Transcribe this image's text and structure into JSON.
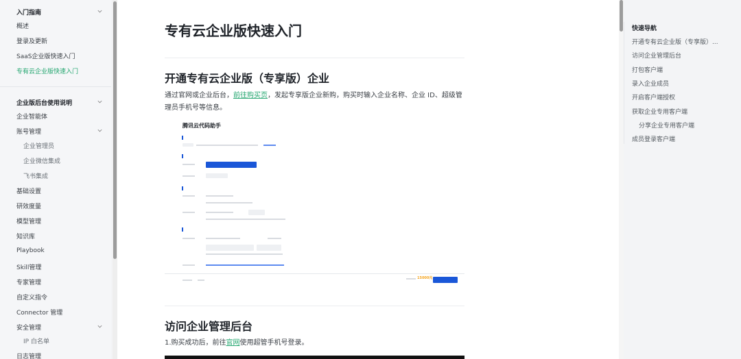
{
  "sidebar": {
    "group1": {
      "title": "入门指南",
      "items": [
        "概述",
        "登录及更新",
        "SaaS企业版快速入门",
        "专有云企业版快速入门"
      ]
    },
    "group2": {
      "title": "企业版后台使用说明",
      "items": [
        {
          "label": "企业智能体",
          "level": 1
        },
        {
          "label": "账号管理",
          "level": 1,
          "expanded": true
        },
        {
          "label": "企业管理员",
          "level": 2
        },
        {
          "label": "企业微信集成",
          "level": 2
        },
        {
          "label": "飞书集成",
          "level": 2
        },
        {
          "label": "基础设置",
          "level": 1
        },
        {
          "label": "研效度量",
          "level": 1
        },
        {
          "label": "模型管理",
          "level": 1
        },
        {
          "label": "知识库",
          "level": 1
        },
        {
          "label": "Playbook",
          "level": 1
        },
        {
          "label": "Skill管理",
          "level": 1
        },
        {
          "label": "专家管理",
          "level": 1
        },
        {
          "label": "自定义指令",
          "level": 1
        },
        {
          "label": "Connector 管理",
          "level": 1
        },
        {
          "label": "安全管理",
          "level": 1,
          "expanded": true
        },
        {
          "label": "IP 白名单",
          "level": 2
        },
        {
          "label": "日志管理",
          "level": 1
        }
      ]
    },
    "active_item": "专有云企业版快速入门",
    "active_color": "#23a66f"
  },
  "main": {
    "title": "专有云企业版快速入门",
    "section1": {
      "heading": "开通专有云企业版（专享版）企业",
      "text_before": "通过官网或企业后台，",
      "link": "前往购买页",
      "text_after": "，发起专享版企业新购，购买时输入企业名称、企业 ID、超级管理员手机号等信息。"
    },
    "screenshot": {
      "title": "腾讯云代码助手",
      "price": "15000元"
    },
    "section2": {
      "heading": "访问企业管理后台",
      "text_before": "1.购买成功后，前往",
      "link": "官网",
      "text_after": "使用超管手机号登录。"
    }
  },
  "toc": {
    "title": "快速导航",
    "items": [
      {
        "label": "开通专有云企业版（专享版）...",
        "level": 1
      },
      {
        "label": "访问企业管理后台",
        "level": 1
      },
      {
        "label": "打包客户端",
        "level": 1
      },
      {
        "label": "录入企业成员",
        "level": 1
      },
      {
        "label": "开启客户端授权",
        "level": 1
      },
      {
        "label": "获取企业专用客户端",
        "level": 1
      },
      {
        "label": "分享企业专用客户端",
        "level": 2
      },
      {
        "label": "成员登录客户端",
        "level": 1
      }
    ]
  }
}
